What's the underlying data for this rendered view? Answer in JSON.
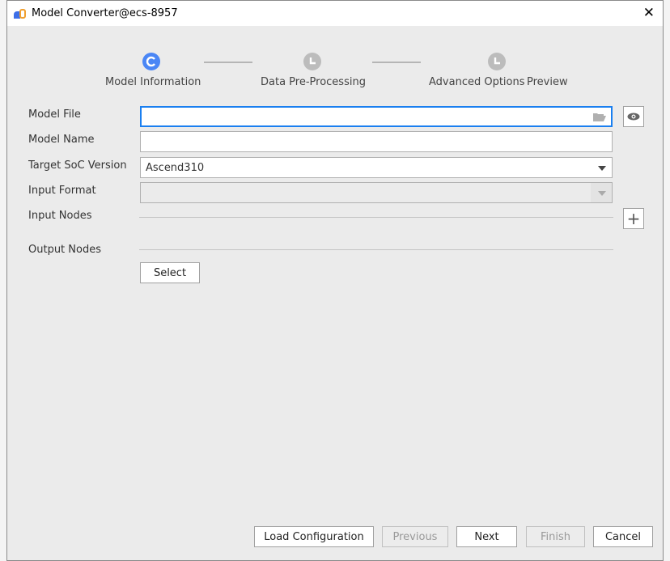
{
  "window": {
    "title": "Model Converter@ecs-8957"
  },
  "steps": [
    {
      "label": "Model Information",
      "state": "active"
    },
    {
      "label": "Data Pre-Processing",
      "state": "pending"
    },
    {
      "label": "Advanced Options",
      "state": "pending"
    },
    {
      "label": "Preview",
      "state": "pending"
    }
  ],
  "form": {
    "model_file": {
      "label": "Model File",
      "value": ""
    },
    "model_name": {
      "label": "Model Name",
      "value": ""
    },
    "target_soc": {
      "label": "Target SoC Version",
      "value": "Ascend310"
    },
    "input_format": {
      "label": "Input Format",
      "value": ""
    },
    "input_nodes": {
      "label": "Input Nodes"
    },
    "output_nodes": {
      "label": "Output Nodes",
      "select_label": "Select"
    }
  },
  "footer": {
    "load": "Load Configuration",
    "previous": "Previous",
    "next": "Next",
    "finish": "Finish",
    "cancel": "Cancel"
  },
  "colors": {
    "accent": "#4a86f5",
    "focus_border": "#1a7ff0",
    "pending": "#bcbcbc"
  }
}
